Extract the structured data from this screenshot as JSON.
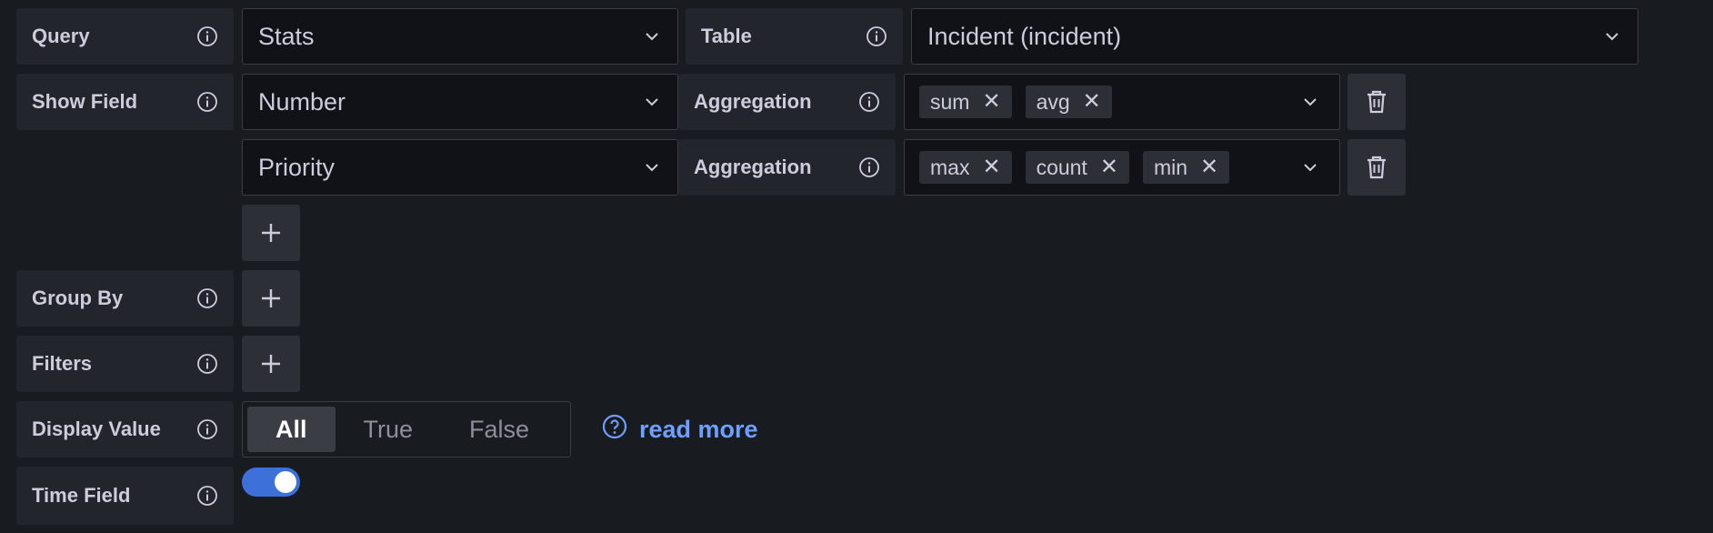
{
  "rows": {
    "query": {
      "label": "Query"
    },
    "show_field": {
      "label": "Show Field"
    },
    "group_by": {
      "label": "Group By"
    },
    "filters": {
      "label": "Filters"
    },
    "display_value": {
      "label": "Display Value"
    },
    "time_field": {
      "label": "Time Field"
    }
  },
  "query_select": {
    "value": "Stats"
  },
  "table": {
    "label": "Table",
    "value": "Incident (incident)"
  },
  "fields": [
    {
      "value": "Number",
      "aggregation_label": "Aggregation",
      "aggregations": [
        "sum",
        "avg"
      ]
    },
    {
      "value": "Priority",
      "aggregation_label": "Aggregation",
      "aggregations": [
        "max",
        "count",
        "min"
      ]
    }
  ],
  "display_value": {
    "options": [
      "All",
      "True",
      "False"
    ],
    "selected": "All"
  },
  "read_more": {
    "label": "read more"
  },
  "time_field": {
    "enabled": true
  },
  "icons": {
    "info": "info-circle-icon",
    "chevron": "chevron-down-icon",
    "remove": "times-icon",
    "delete": "trash-alt-icon",
    "add": "plus-icon",
    "help": "question-circle-icon"
  },
  "colors": {
    "background": "#181b1f",
    "label_bg": "#22252b",
    "input_bg": "#111217",
    "accent": "#3d71d9",
    "link": "#6e9fff"
  }
}
